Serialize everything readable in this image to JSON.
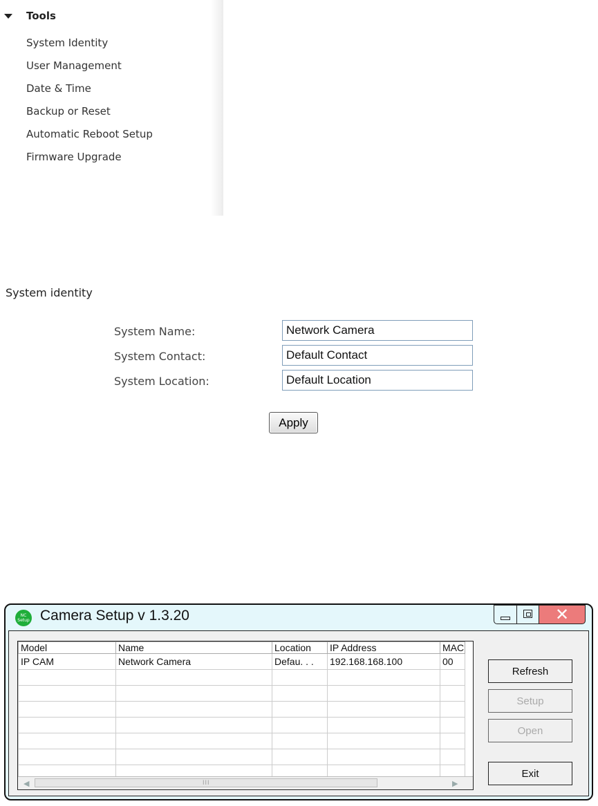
{
  "sidebar": {
    "section_title": "Tools",
    "items": [
      {
        "label": "System Identity"
      },
      {
        "label": "User Management"
      },
      {
        "label": "Date & Time"
      },
      {
        "label": "Backup or Reset"
      },
      {
        "label": "Automatic Reboot Setup"
      },
      {
        "label": "Firmware Upgrade"
      }
    ]
  },
  "identity_form": {
    "title": "System identity",
    "fields": [
      {
        "label": "System Name:",
        "value": "Network Camera"
      },
      {
        "label": "System Contact:",
        "value": "Default Contact"
      },
      {
        "label": "System Location:",
        "value": "Default Location"
      }
    ],
    "apply_label": "Apply"
  },
  "camera_setup": {
    "icon_text_top": "NC",
    "icon_text_bottom": "Setup",
    "title": "Camera Setup v 1.3.20",
    "close_glyph": "✕",
    "columns": [
      "Model",
      "Name",
      "Location",
      "IP Address",
      "MAC"
    ],
    "rows": [
      [
        "IP CAM",
        "Network Camera",
        "Defau. . .",
        "192.168.168.100",
        "00"
      ]
    ],
    "scroll_left": "◀",
    "scroll_right": "▶",
    "scroll_grip": "III",
    "buttons": {
      "refresh": "Refresh",
      "setup": "Setup",
      "open": "Open",
      "exit": "Exit"
    },
    "colors": {
      "title_bg": "#e4f7fb",
      "close_bg": "#ec7b7b",
      "icon_bg": "#1fae3a"
    }
  }
}
